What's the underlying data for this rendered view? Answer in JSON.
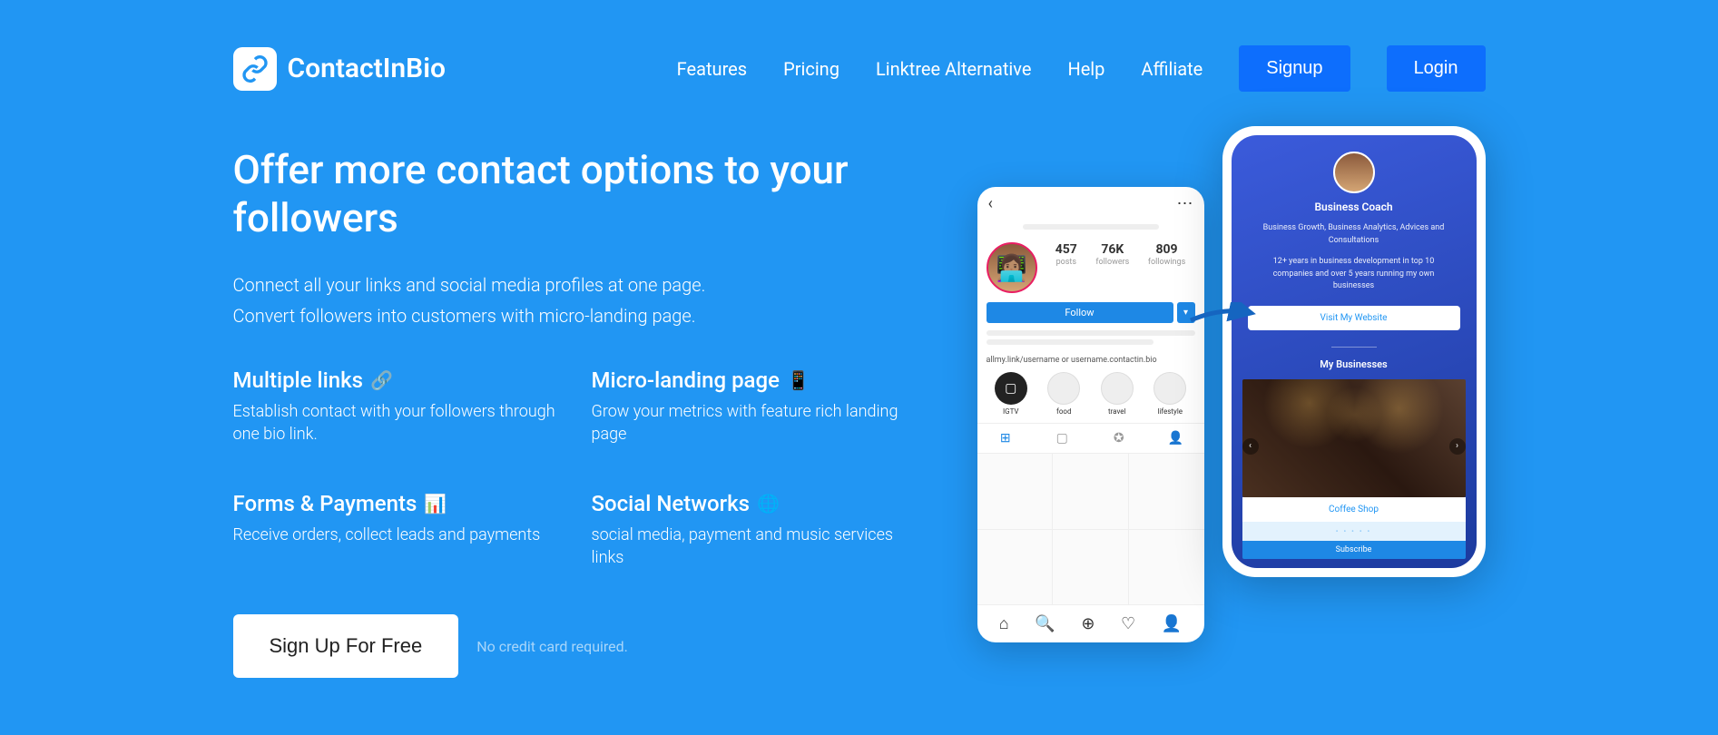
{
  "brand": "ContactInBio",
  "nav": {
    "features": "Features",
    "pricing": "Pricing",
    "linktree": "Linktree Alternative",
    "help": "Help",
    "affiliate": "Affiliate",
    "signup": "Signup",
    "login": "Login"
  },
  "hero": {
    "title": "Offer more contact options to your followers",
    "sub1": "Connect all your links and social media profiles at one page.",
    "sub2": "Convert followers into customers with micro-landing page."
  },
  "features": {
    "multiple_links": {
      "title": "Multiple links",
      "icon": "🔗",
      "desc": "Establish contact with your followers through one bio link."
    },
    "micro_landing": {
      "title": "Micro-landing page",
      "icon": "📱",
      "desc": "Grow your metrics with feature rich landing page"
    },
    "forms_payments": {
      "title": "Forms & Payments",
      "icon": "📊",
      "desc": "Receive orders, collect leads and payments"
    },
    "social_networks": {
      "title": "Social Networks",
      "icon": "🌐",
      "desc": "social media, payment and music services links"
    }
  },
  "cta": {
    "button": "Sign Up For Free",
    "note": "No credit card required."
  },
  "insta": {
    "posts_num": "457",
    "posts_lbl": "posts",
    "followers_num": "76K",
    "followers_lbl": "followers",
    "following_num": "809",
    "following_lbl": "followings",
    "follow_btn": "Follow",
    "bio_link": "allmy.link/username or username.contactin.bio",
    "stories": {
      "igtv": "IGTV",
      "food": "food",
      "travel": "travel",
      "lifestyle": "lifestyle"
    }
  },
  "landing": {
    "title": "Business Coach",
    "desc1": "Business Growth, Business Analytics, Advices and Consultations",
    "desc2": "12+ years in business development in top 10 companies and over 5 years running my own businesses",
    "visit_btn": "Visit My Website",
    "section": "My Businesses",
    "card_title": "Coffee Shop",
    "subscribe": "Subscribe"
  }
}
